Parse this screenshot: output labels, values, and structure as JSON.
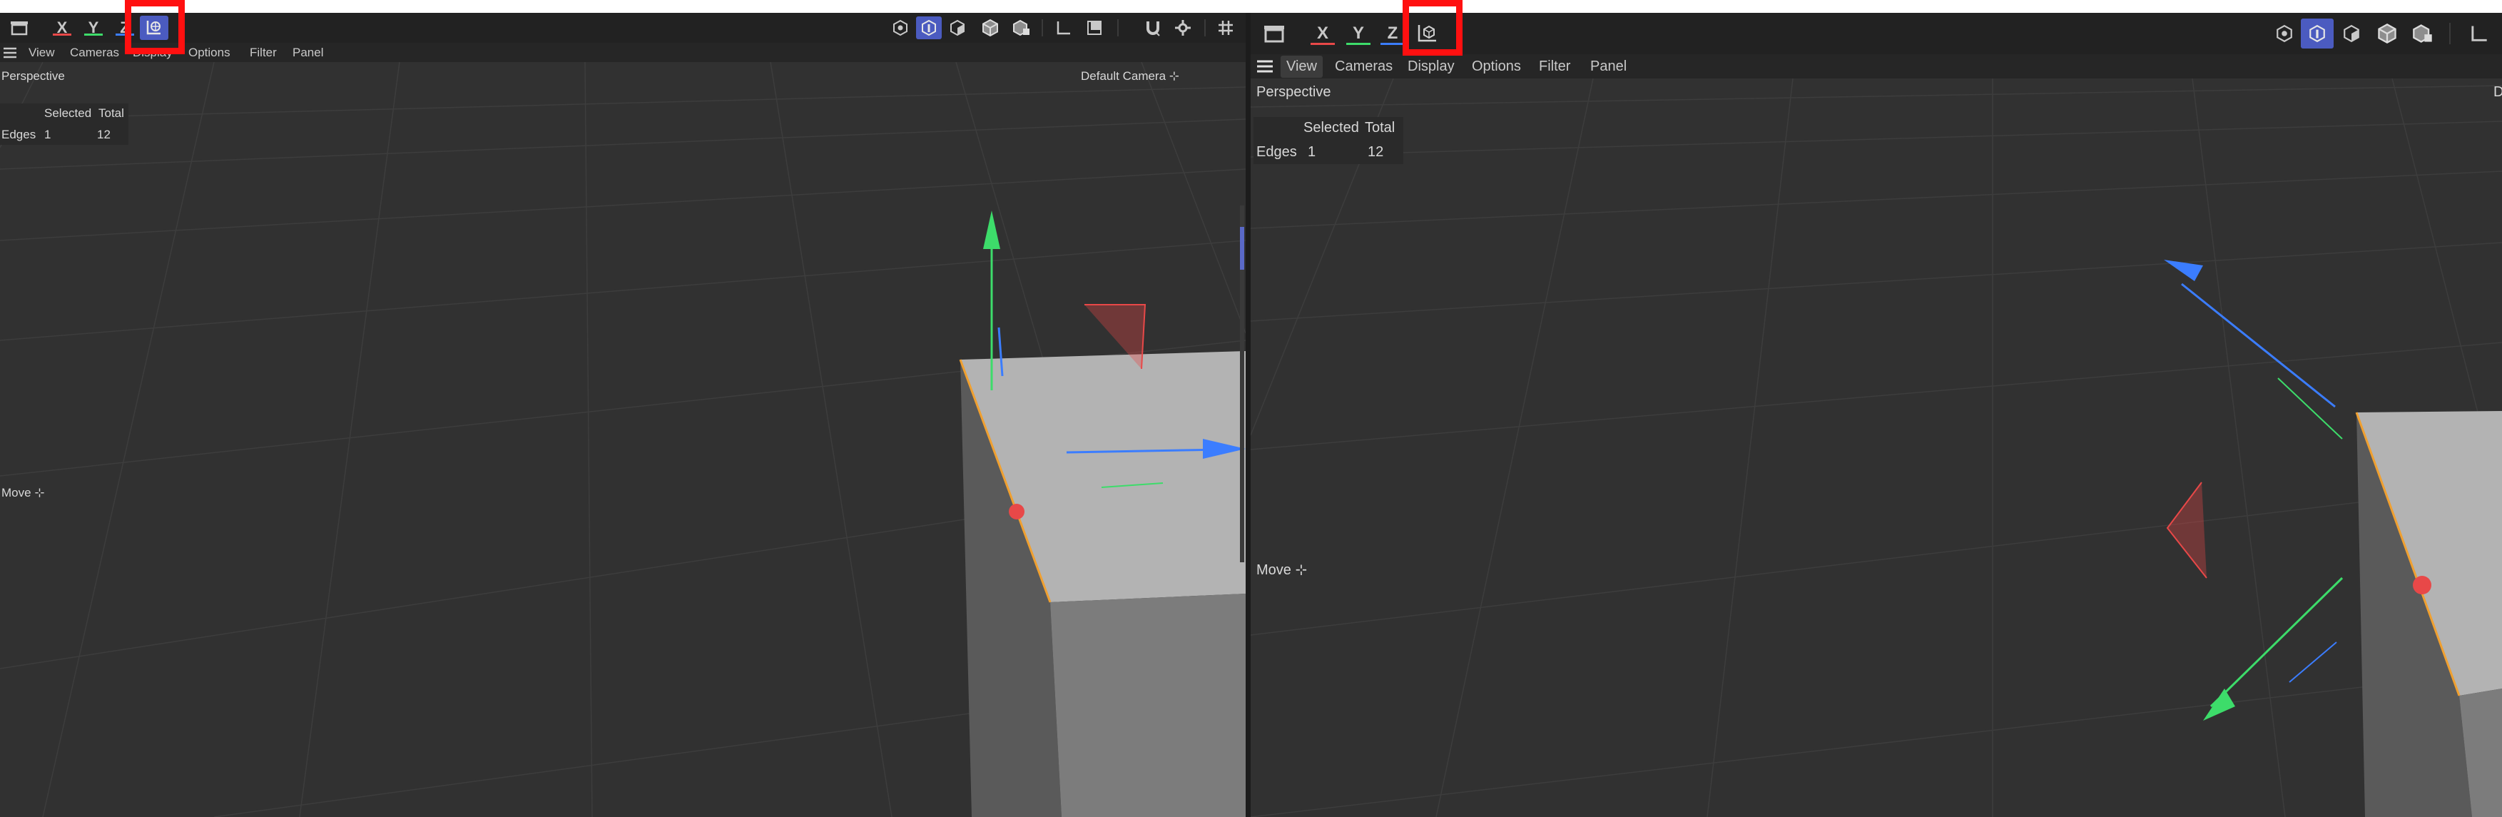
{
  "left": {
    "axes": {
      "x": "X",
      "y": "Y",
      "z": "Z"
    },
    "menu": [
      "View",
      "Cameras",
      "Display",
      "Options",
      "Filter",
      "Panel"
    ],
    "view_label": "Perspective",
    "camera_label": "Default Camera",
    "hud": {
      "col_selected": "Selected",
      "col_total": "Total",
      "row_label": "Edges",
      "selected": "1",
      "total": "12"
    },
    "tool_label": "Move"
  },
  "right": {
    "axes": {
      "x": "X",
      "y": "Y",
      "z": "Z"
    },
    "menu": [
      "View",
      "Cameras",
      "Display",
      "Options",
      "Filter",
      "Panel"
    ],
    "view_label": "Perspective",
    "camera_label_partial": "D",
    "hud": {
      "col_selected": "Selected",
      "col_total": "Total",
      "row_label": "Edges",
      "selected": "1",
      "total": "12"
    },
    "tool_label": "Move"
  },
  "colors": {
    "highlight": "#ff1010",
    "active_button": "#4b5bc0",
    "axis_x": "#e84848",
    "axis_y": "#3ddc6a",
    "axis_z": "#3b7dff",
    "edge_select": "#f0a030"
  }
}
